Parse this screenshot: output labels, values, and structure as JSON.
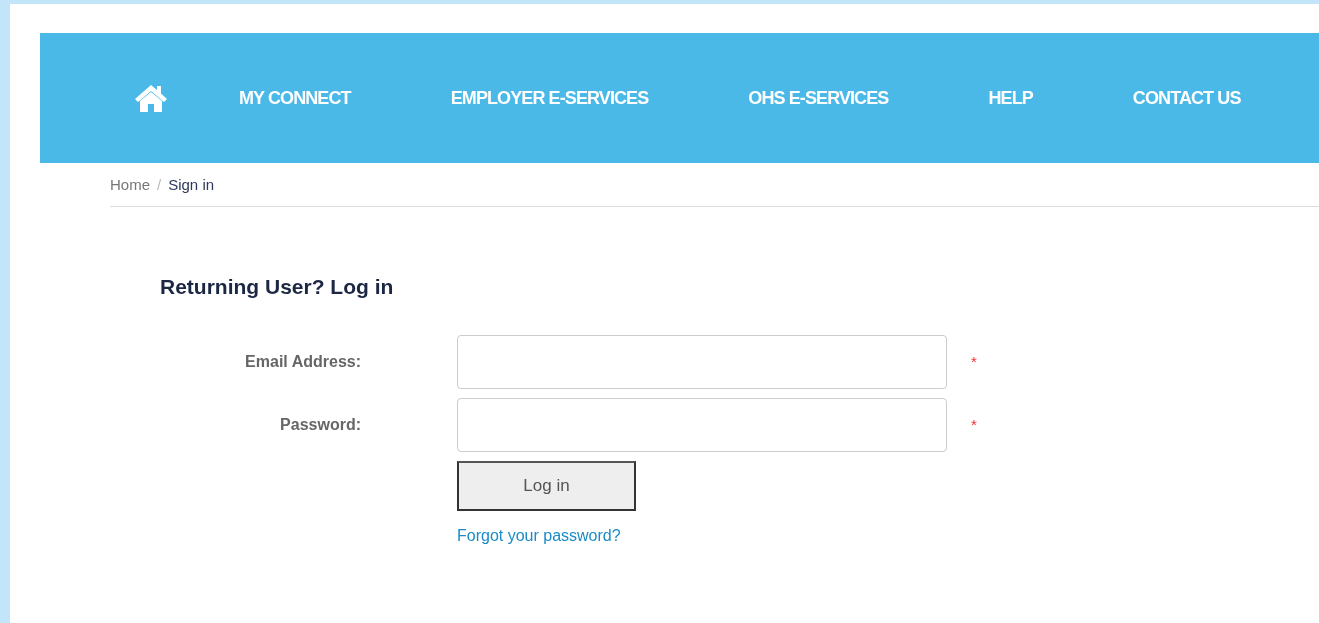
{
  "nav": {
    "items": [
      {
        "label": "MY CONNECT"
      },
      {
        "label": "EMPLOYER E-SERVICES"
      },
      {
        "label": "OHS E-SERVICES"
      },
      {
        "label": "HELP"
      },
      {
        "label": "CONTACT US"
      }
    ]
  },
  "breadcrumb": [
    {
      "label": "Home",
      "current": false
    },
    {
      "label": "Sign in",
      "current": true
    }
  ],
  "breadcrumb_separator": "/",
  "login": {
    "title": "Returning User? Log in",
    "fields": [
      {
        "label": "Email Address:",
        "required_mark": "*"
      },
      {
        "label": "Password:",
        "required_mark": "*"
      }
    ],
    "button": "Log in",
    "forgot_link": "Forgot your password?"
  }
}
